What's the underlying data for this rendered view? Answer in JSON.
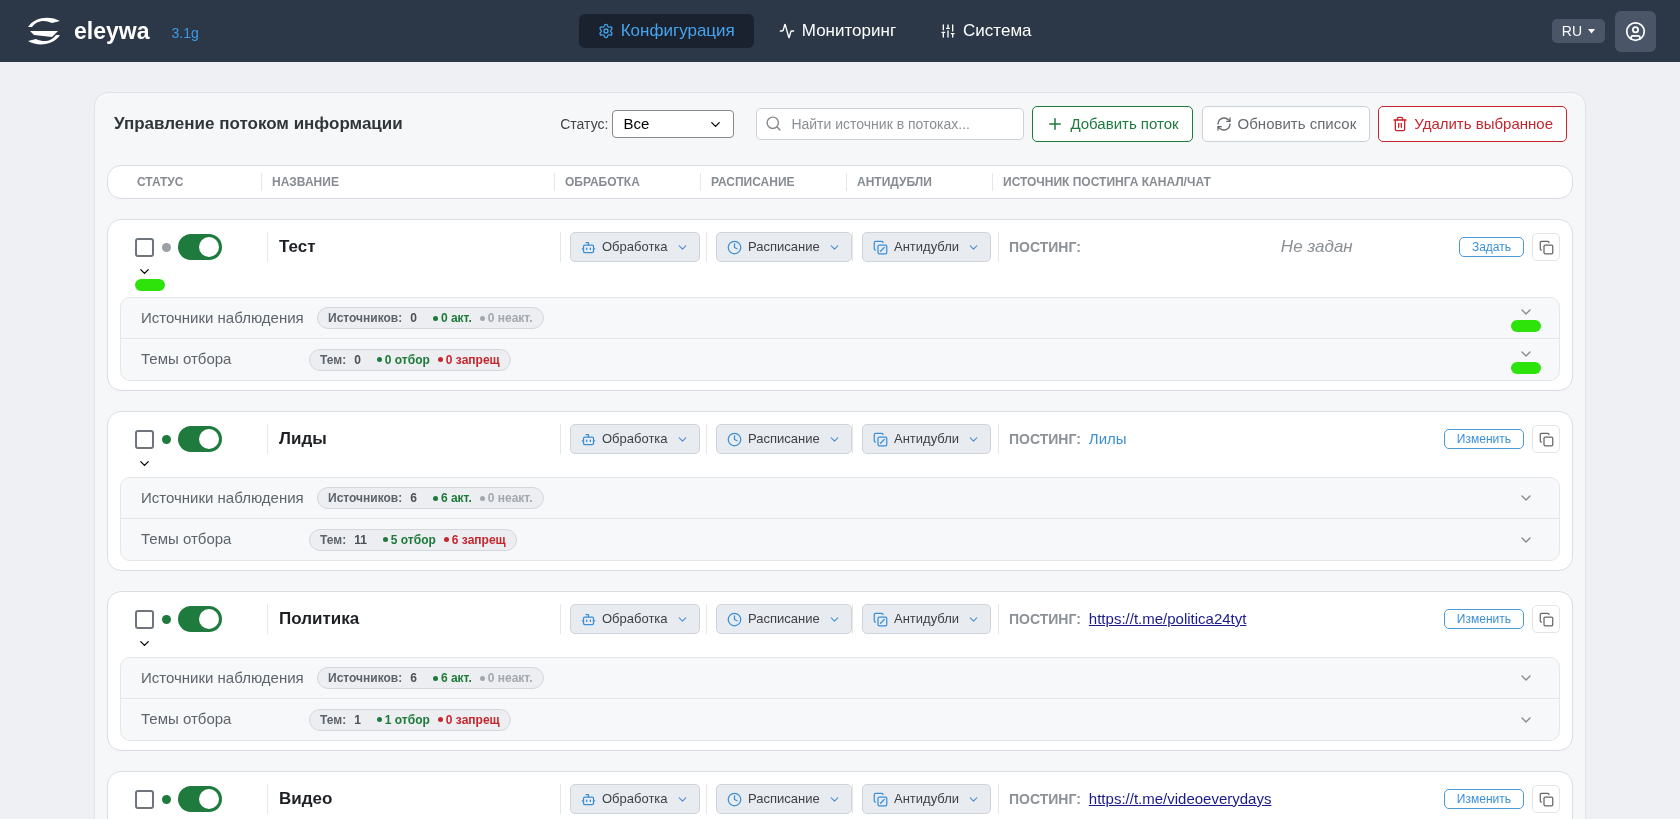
{
  "header": {
    "brand": "eleywa",
    "version": "3.1g",
    "nav": [
      {
        "label": "Конфигурация",
        "selected": true,
        "kind": "gear"
      },
      {
        "label": "Мониторинг",
        "selected": false,
        "kind": "pulse"
      },
      {
        "label": "Система",
        "selected": false,
        "kind": "sliders"
      }
    ],
    "language": "RU"
  },
  "panel": {
    "title": "Управление потоком информации",
    "status_label": "Статус:",
    "status_value": "Все",
    "search_placeholder": "Найти источник в потоках...",
    "add_button": "Добавить поток",
    "refresh_button": "Обновить список",
    "delete_button": "Удалить выбранное"
  },
  "columns": [
    "СТАТУС",
    "НАЗВАНИЕ",
    "ОБРАБОТКА",
    "РАСПИСАНИЕ",
    "АНТИДУБЛИ",
    "ИСТОЧНИК ПОСТИНГА КАНАЛ/ЧАТ"
  ],
  "flows": [
    {
      "name": "Тест",
      "checked": false,
      "active": false,
      "on": true,
      "marker": true,
      "processing": "Обработка",
      "schedule": "Расписание",
      "antidup": "Антидубли",
      "posting_label": "ПОСТИНГ:",
      "posting": {
        "kind": "unset",
        "text": "Не задан"
      },
      "action": "Задать",
      "sources": {
        "label": "Источники наблюдения",
        "count_label": "Источников:",
        "count": "0",
        "good": "0 акт.",
        "bad": "0 неакт.",
        "marker": true
      },
      "topics": {
        "label": "Темы отбора",
        "count_label": "Тем:",
        "count": "0",
        "good": "0 отбор",
        "bad": "0 запрещ",
        "marker": true
      }
    },
    {
      "name": "Лиды",
      "checked": false,
      "active": true,
      "on": true,
      "marker": false,
      "processing": "Обработка",
      "schedule": "Расписание",
      "antidup": "Антидубли",
      "posting_label": "ПОСТИНГ:",
      "posting": {
        "kind": "name",
        "text": "Лилы"
      },
      "action": "Изменить",
      "sources": {
        "label": "Источники наблюдения",
        "count_label": "Источников:",
        "count": "6",
        "good": "6 акт.",
        "bad": "0 неакт.",
        "marker": false
      },
      "topics": {
        "label": "Темы отбора",
        "count_label": "Тем:",
        "count": "11",
        "good": "5 отбор",
        "bad": "6 запрещ",
        "marker": false
      }
    },
    {
      "name": "Политика",
      "checked": false,
      "active": true,
      "on": true,
      "marker": false,
      "processing": "Обработка",
      "schedule": "Расписание",
      "antidup": "Антидубли",
      "posting_label": "ПОСТИНГ:",
      "posting": {
        "kind": "link",
        "text": "https://t.me/politica24tyt"
      },
      "action": "Изменить",
      "sources": {
        "label": "Источники наблюдения",
        "count_label": "Источников:",
        "count": "6",
        "good": "6 акт.",
        "bad": "0 неакт.",
        "marker": false
      },
      "topics": {
        "label": "Темы отбора",
        "count_label": "Тем:",
        "count": "1",
        "good": "1 отбор",
        "bad": "0 запрещ",
        "marker": false
      }
    },
    {
      "name": "Видео",
      "checked": false,
      "active": true,
      "on": true,
      "marker": false,
      "processing": "Обработка",
      "schedule": "Расписание",
      "antidup": "Антидубли",
      "posting_label": "ПОСТИНГ:",
      "posting": {
        "kind": "link",
        "text": "https://t.me/videoeverydays"
      },
      "action": "Изменить"
    }
  ]
}
